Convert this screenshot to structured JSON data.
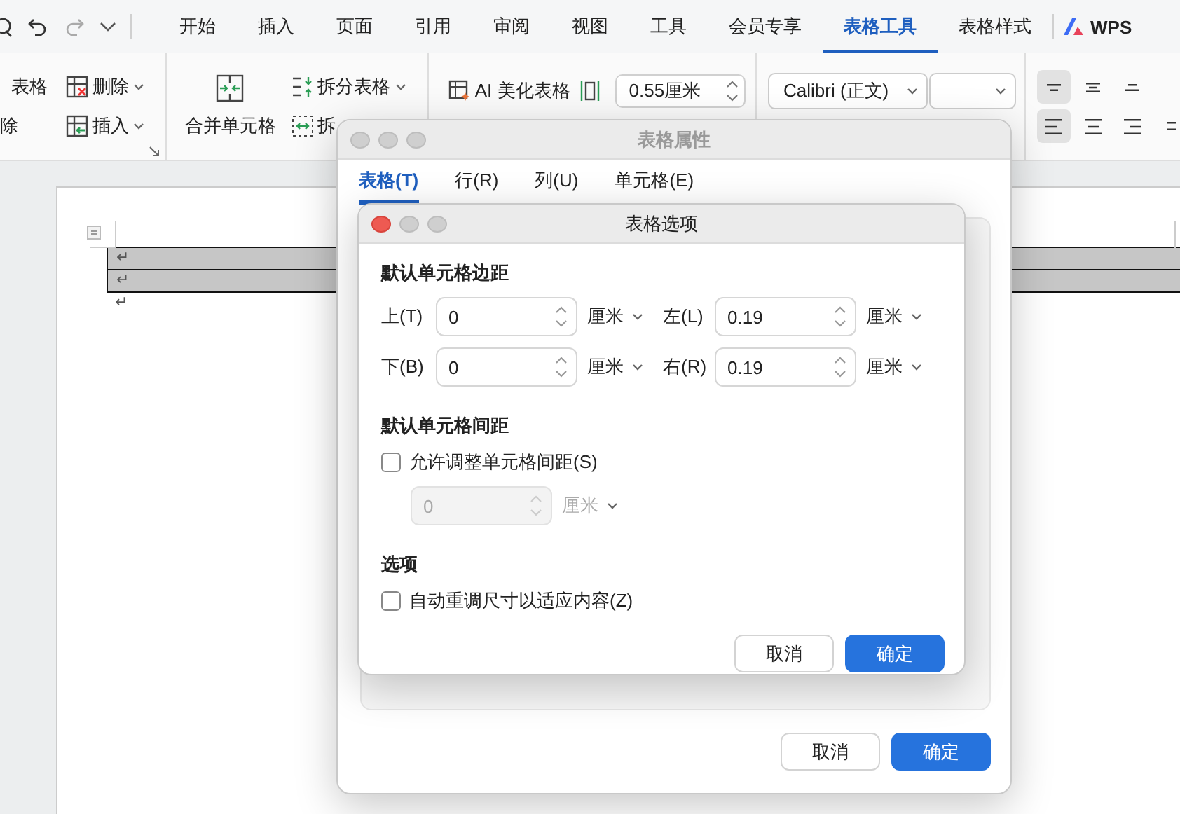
{
  "menu_tabs": [
    {
      "label": "开始",
      "selected": false
    },
    {
      "label": "插入",
      "selected": false
    },
    {
      "label": "页面",
      "selected": false
    },
    {
      "label": "引用",
      "selected": false
    },
    {
      "label": "审阅",
      "selected": false
    },
    {
      "label": "视图",
      "selected": false
    },
    {
      "label": "工具",
      "selected": false
    },
    {
      "label": "会员专享",
      "selected": false
    },
    {
      "label": "表格工具",
      "selected": true
    },
    {
      "label": "表格样式",
      "selected": false
    }
  ],
  "brand_label": "WPS",
  "ribbon": {
    "partial_labels": [
      "表格",
      "除"
    ],
    "row_buttons": [
      {
        "label": "删除",
        "dropdown": true
      },
      {
        "label": "插入",
        "dropdown": true
      }
    ],
    "merge_button": {
      "label": "合并单元格"
    },
    "split_buttons": [
      {
        "label": "拆分表格",
        "dropdown": true
      },
      {
        "label": "拆"
      }
    ],
    "beautify_button": {
      "label": "AI 美化表格"
    },
    "width_field": {
      "value": "0.55厘米"
    },
    "font_select": {
      "value": "Calibri (正文)"
    },
    "align_buttons": [
      {
        "selected": true
      },
      {
        "selected": false
      },
      {
        "selected": false
      },
      {
        "selected": true
      },
      {
        "selected": false
      },
      {
        "selected": false
      },
      {
        "selected": false
      }
    ]
  },
  "document": {
    "table": {
      "rows": [
        {
          "mark": "↵"
        },
        {
          "mark": "↵"
        }
      ]
    },
    "after_mark": "↵"
  },
  "properties_dialog": {
    "title": "表格属性",
    "tabs": [
      {
        "label": "表格(T)",
        "selected": true
      },
      {
        "label": "行(R)",
        "selected": false
      },
      {
        "label": "列(U)",
        "selected": false
      },
      {
        "label": "单元格(E)",
        "selected": false
      }
    ],
    "buttons": [
      {
        "label": "取消",
        "kind": "secondary"
      },
      {
        "label": "确定",
        "kind": "primary"
      }
    ]
  },
  "options_dialog": {
    "title": "表格选项",
    "margins": {
      "heading": "默认单元格边距",
      "fields": [
        {
          "label": "上(T)",
          "value": "0",
          "unit": "厘米"
        },
        {
          "label": "左(L)",
          "value": "0.19",
          "unit": "厘米"
        },
        {
          "label": "下(B)",
          "value": "0",
          "unit": "厘米"
        },
        {
          "label": "右(R)",
          "value": "0.19",
          "unit": "厘米"
        }
      ]
    },
    "spacing": {
      "heading": "默认单元格间距",
      "checkbox": {
        "label": "允许调整单元格间距(S)",
        "checked": false
      },
      "field": {
        "value": "0",
        "unit": "厘米",
        "disabled": true
      }
    },
    "options": {
      "heading": "选项",
      "checkbox": {
        "label": "自动重调尺寸以适应内容(Z)",
        "checked": false
      }
    },
    "buttons": [
      {
        "label": "取消",
        "kind": "secondary"
      },
      {
        "label": "确定",
        "kind": "primary"
      }
    ]
  }
}
